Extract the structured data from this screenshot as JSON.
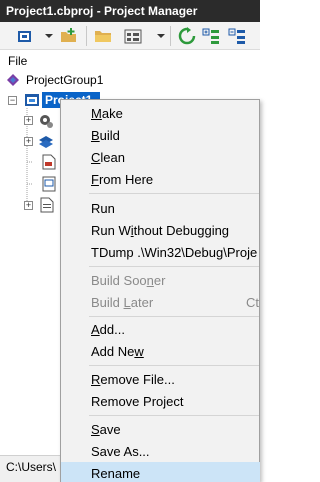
{
  "window": {
    "title": "Project1.cbproj - Project Manager"
  },
  "panel": {
    "label": "File"
  },
  "tree": {
    "group": "ProjectGroup1",
    "project": "Project1"
  },
  "status": {
    "path": "C:\\Users\\"
  },
  "menu": {
    "items": [
      {
        "pre": "",
        "key": "M",
        "post": "ake",
        "shortcut": ""
      },
      {
        "pre": "",
        "key": "B",
        "post": "uild",
        "shortcut": ""
      },
      {
        "pre": "",
        "key": "C",
        "post": "lean",
        "shortcut": ""
      },
      {
        "pre": "",
        "key": "F",
        "post": "rom Here",
        "shortcut": ""
      },
      {
        "pre": "Ru",
        "key": "",
        "post": "n",
        "shortcut": ""
      },
      {
        "pre": "Run W",
        "key": "i",
        "post": "thout Debugging",
        "shortcut": ""
      },
      {
        "pre": "TDump .\\Win32\\Debug\\Proje",
        "key": "",
        "post": "",
        "shortcut": ""
      },
      {
        "pre": "Build Soo",
        "key": "n",
        "post": "er",
        "shortcut": ""
      },
      {
        "pre": "Build ",
        "key": "L",
        "post": "ater",
        "shortcut": "Ct"
      },
      {
        "pre": "",
        "key": "A",
        "post": "dd...",
        "shortcut": ""
      },
      {
        "pre": "Add Ne",
        "key": "w",
        "post": "",
        "shortcut": ""
      },
      {
        "pre": "",
        "key": "R",
        "post": "emove File...",
        "shortcut": ""
      },
      {
        "pre": "Remove Project",
        "key": "",
        "post": "",
        "shortcut": ""
      },
      {
        "pre": "",
        "key": "S",
        "post": "ave",
        "shortcut": ""
      },
      {
        "pre": "Save As...",
        "key": "",
        "post": "",
        "shortcut": ""
      },
      {
        "pre": "Rename",
        "key": "",
        "post": "",
        "shortcut": ""
      }
    ]
  },
  "colors": {
    "titlebar": "#2b2b2b",
    "selection": "#0a64c8",
    "menu_hover": "#cce4f7",
    "disabled_text": "#8a8a8a"
  }
}
